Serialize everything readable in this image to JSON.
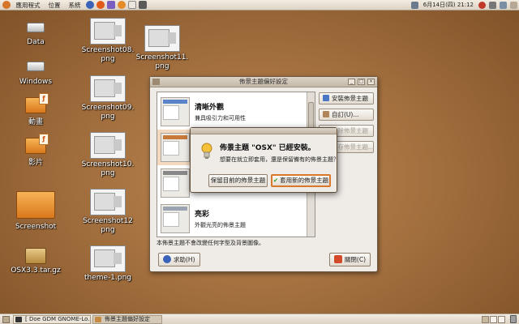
{
  "top_panel": {
    "menus": [
      "應用程式",
      "位置",
      "系統"
    ],
    "clock": "6月14日(四) 21:12"
  },
  "desktop": {
    "icons": [
      {
        "label": "Data"
      },
      {
        "label": "Windows"
      },
      {
        "label": "動畫"
      },
      {
        "label": "影片"
      },
      {
        "label": "Screenshot"
      },
      {
        "label": "OSX3.3.tar.gz"
      },
      {
        "label": "Screenshot08.\npng"
      },
      {
        "label": "Screenshot09.\npng"
      },
      {
        "label": "Screenshot10.\npng"
      },
      {
        "label": "Screenshot12\npng"
      },
      {
        "label": "theme-1.png"
      },
      {
        "label": "Screenshot11.\npng"
      }
    ]
  },
  "theme_window": {
    "title": "佈景主題偏好設定",
    "themes": [
      {
        "name": "清晰外觀",
        "desc": "兼具吸引力和可用性"
      },
      {
        "name": "亮彩",
        "desc": "外觀光亮的佈景主題"
      }
    ],
    "buttons": {
      "install": "安裝佈景主題",
      "customize": "自訂(U)...",
      "remove": "移除佈景主題",
      "save": "儲存佈景主題..."
    },
    "info": "本佈景主題不會改變任何字型及背景圖像。",
    "help": "求助(H)",
    "close": "關閉(C)"
  },
  "dialog": {
    "title": "佈景主題 \"OSX\" 已經安裝。",
    "message": "想要在就立即套用，還是保留備有的佈景主題？",
    "keep": "保留目前的佈景主題",
    "apply": "套用新的佈景主題"
  },
  "bottom_panel": {
    "tasks": [
      "[ Doe GDM GNOME-Lo...",
      "佈景主題偏好設定"
    ]
  },
  "colors": {
    "desktop_center": "#c08a52",
    "desktop_edge": "#7f5127",
    "selection": "#f2d9bf",
    "default_button_border": "#d9782d"
  }
}
